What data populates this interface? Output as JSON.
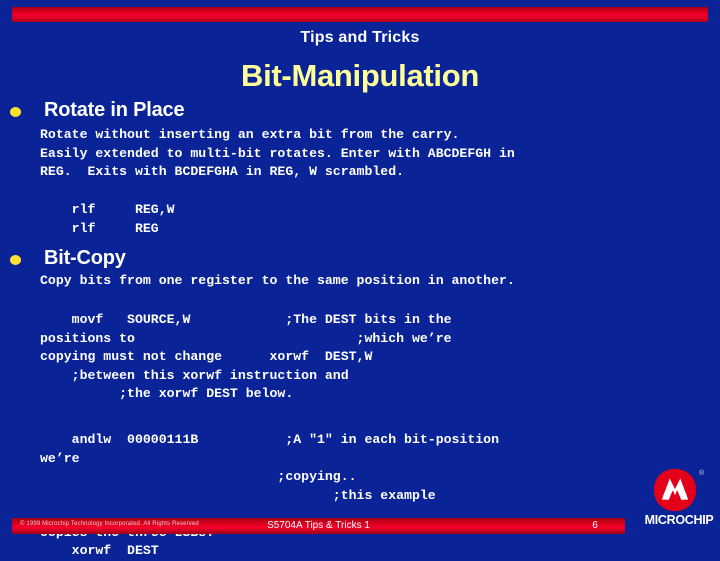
{
  "slide": {
    "kicker": "Tips and Tricks",
    "title": "Bit-Manipulation",
    "background_color": "#0a2396",
    "title_color": "#ffff99",
    "accent_color": "#e00020",
    "bullet_color": "#ffe033"
  },
  "sections": [
    {
      "heading": "Rotate in Place",
      "description": "Rotate without inserting an extra bit from the carry.\nEasily extended to multi-bit rotates. Enter with ABCDEFGH in\nREG.  Exits with BCDEFGHA in REG, W scrambled.",
      "code": "    rlf     REG,W\n    rlf     REG"
    },
    {
      "heading": "Bit-Copy",
      "description": "Copy bits from one register to the same position in another.",
      "code_1": "    movf   SOURCE,W            ;The DEST bits in the\npositions to                            ;which we’re\ncopying must not change      xorwf  DEST,W\n    ;between this xorwf instruction and\n          ;the xorwf DEST below.",
      "code_2": "    andlw  00000111B           ;A \"1\" in each bit-position\nwe’re\n                              ;copying..\n                                     ;this example\n\ncopies the three LSBs.\n    xorwf  DEST"
    }
  ],
  "footer": {
    "copyright": "© 1999 Microchip Technology Incorporated. All Rights Reserved",
    "center_text": "S5704A Tips & Tricks 1",
    "page_number": "6"
  },
  "logo": {
    "wordmark": "MICROCHIP",
    "registered": "®"
  }
}
